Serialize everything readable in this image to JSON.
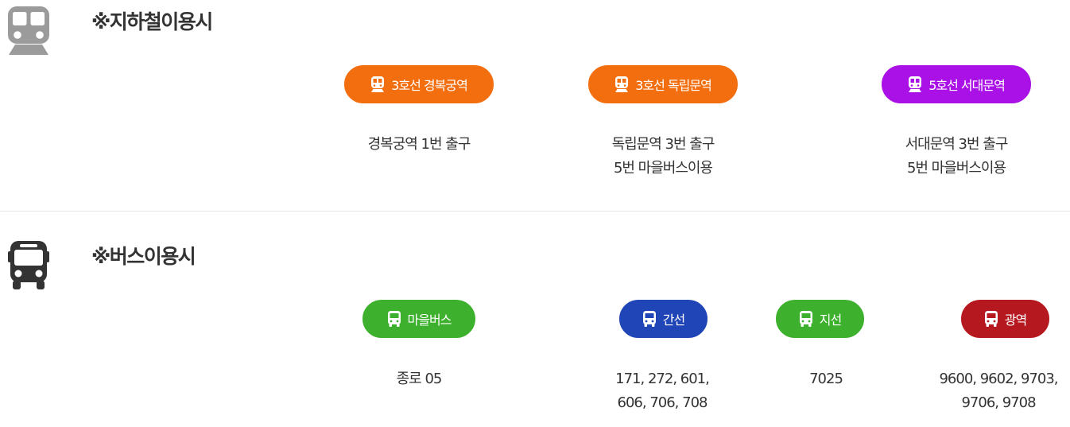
{
  "subway": {
    "title": "※지하철이용시",
    "icon": "subway-icon",
    "stations": [
      {
        "label": "3호선 경복궁역",
        "color": "#f36e0e",
        "info": [
          "경복궁역 1번 출구"
        ]
      },
      {
        "label": "3호선 독립문역",
        "color": "#f36e0e",
        "info": [
          "독립문역 3번 출구",
          "5번 마을버스이용"
        ]
      },
      {
        "label": "5호선 서대문역",
        "color": "#aa11e6",
        "info": [
          "서대문역 3번 출구",
          "5번 마을버스이용"
        ]
      }
    ]
  },
  "bus": {
    "title": "※버스이용시",
    "icon": "bus-icon",
    "routes": [
      {
        "label": "마을버스",
        "color": "#3db12d",
        "info": [
          "종로 05"
        ]
      },
      {
        "label": "간선",
        "color": "#1f45b6",
        "info": [
          "171, 272, 601,",
          "606, 706, 708"
        ]
      },
      {
        "label": "지선",
        "color": "#3db12d",
        "info": [
          "7025"
        ]
      },
      {
        "label": "광역",
        "color": "#b5181e",
        "info": [
          "9600, 9602, 9703,",
          "9706, 9708"
        ]
      }
    ]
  }
}
